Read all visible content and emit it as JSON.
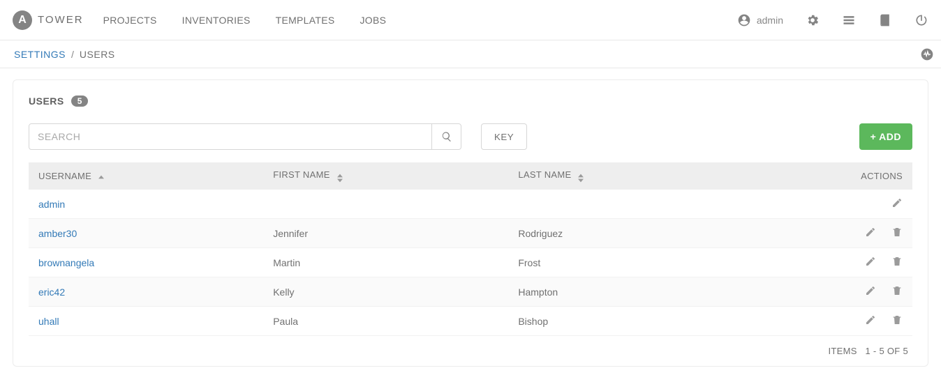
{
  "header": {
    "brand": "TOWER",
    "nav": [
      "PROJECTS",
      "INVENTORIES",
      "TEMPLATES",
      "JOBS"
    ],
    "user": "admin"
  },
  "breadcrumb": {
    "parent": "SETTINGS",
    "separator": "/",
    "current": "USERS"
  },
  "panel": {
    "title": "USERS",
    "count": "5"
  },
  "toolbar": {
    "search_placeholder": "SEARCH",
    "key_label": "KEY",
    "add_label": "+ ADD"
  },
  "table": {
    "columns": {
      "username": "USERNAME",
      "first_name": "FIRST NAME",
      "last_name": "LAST NAME",
      "actions": "ACTIONS"
    },
    "rows": [
      {
        "username": "admin",
        "first_name": "",
        "last_name": "",
        "can_delete": false
      },
      {
        "username": "amber30",
        "first_name": "Jennifer",
        "last_name": "Rodriguez",
        "can_delete": true
      },
      {
        "username": "brownangela",
        "first_name": "Martin",
        "last_name": "Frost",
        "can_delete": true
      },
      {
        "username": "eric42",
        "first_name": "Kelly",
        "last_name": "Hampton",
        "can_delete": true
      },
      {
        "username": "uhall",
        "first_name": "Paula",
        "last_name": "Bishop",
        "can_delete": true
      }
    ]
  },
  "pager": {
    "label": "ITEMS",
    "range": "1 - 5 OF 5"
  }
}
